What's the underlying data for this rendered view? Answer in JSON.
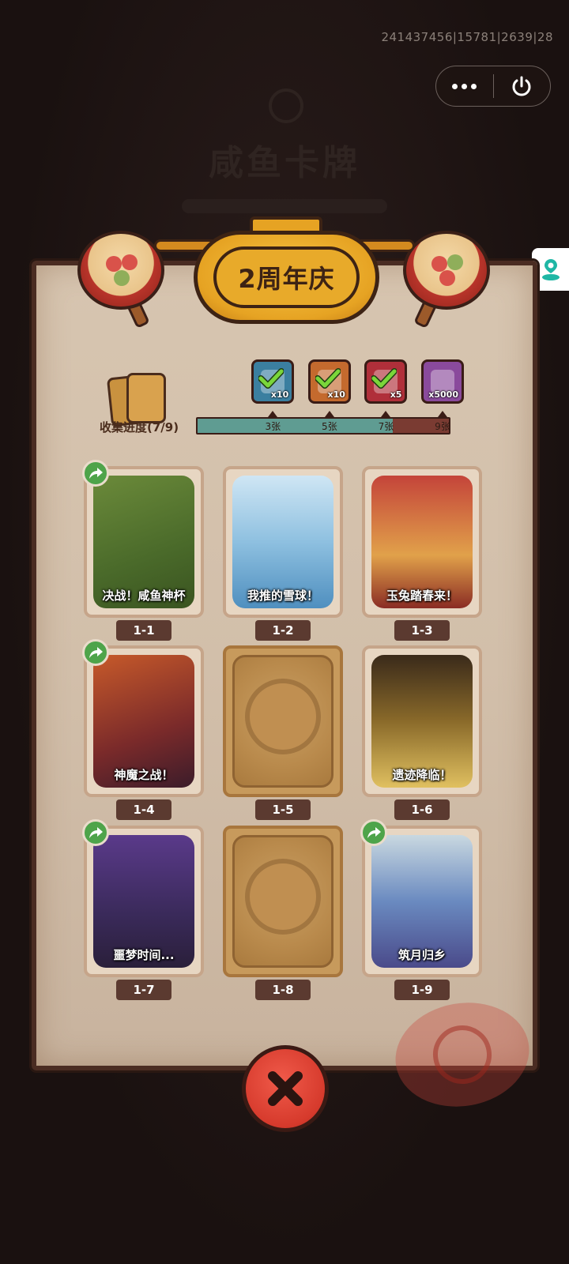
{
  "status": {
    "session_id": "241437456|15781|2639|28"
  },
  "background": {
    "title": "咸鱼卡牌"
  },
  "capsule": {
    "more_icon": "more-dots-icon",
    "close_icon": "power-icon"
  },
  "side_tab": {
    "icon": "map-pin-icon"
  },
  "event": {
    "title": "2周年庆"
  },
  "progress": {
    "label": "收集进度(7/9)",
    "collected": 7,
    "total": 9,
    "milestones": [
      {
        "label": "3张",
        "count": 3,
        "reward": "x10",
        "reward_icon": "chest-icon",
        "claimed": true
      },
      {
        "label": "5张",
        "count": 5,
        "reward": "x10",
        "reward_icon": "key-icon",
        "claimed": true
      },
      {
        "label": "7张",
        "count": 7,
        "reward": "x5",
        "reward_icon": "orb-icon",
        "claimed": true
      },
      {
        "label": "9张",
        "count": 9,
        "reward": "x5000",
        "reward_icon": "crystal-icon",
        "claimed": false
      }
    ]
  },
  "cards": [
    {
      "number": "1-1",
      "caption": "决战！咸鱼神杯",
      "unlocked": true,
      "shareable": true
    },
    {
      "number": "1-2",
      "caption": "我推的雪球！",
      "unlocked": true,
      "shareable": false
    },
    {
      "number": "1-3",
      "caption": "玉兔踏春来！",
      "unlocked": true,
      "shareable": false
    },
    {
      "number": "1-4",
      "caption": "神魔之战！",
      "unlocked": true,
      "shareable": true
    },
    {
      "number": "1-5",
      "caption": "",
      "unlocked": false,
      "shareable": false
    },
    {
      "number": "1-6",
      "caption": "遗迹降临！",
      "unlocked": true,
      "shareable": false
    },
    {
      "number": "1-7",
      "caption": "噩梦时间...",
      "unlocked": true,
      "shareable": true
    },
    {
      "number": "1-8",
      "caption": "",
      "unlocked": false,
      "shareable": false
    },
    {
      "number": "1-9",
      "caption": "筑月归乡",
      "unlocked": true,
      "shareable": true
    }
  ],
  "colors": {
    "accent_gold": "#e6a323",
    "progress_fill": "#5f9c92",
    "progress_empty": "#7a3b32",
    "share_green": "#4ea44a",
    "close_red": "#d63a2c"
  }
}
